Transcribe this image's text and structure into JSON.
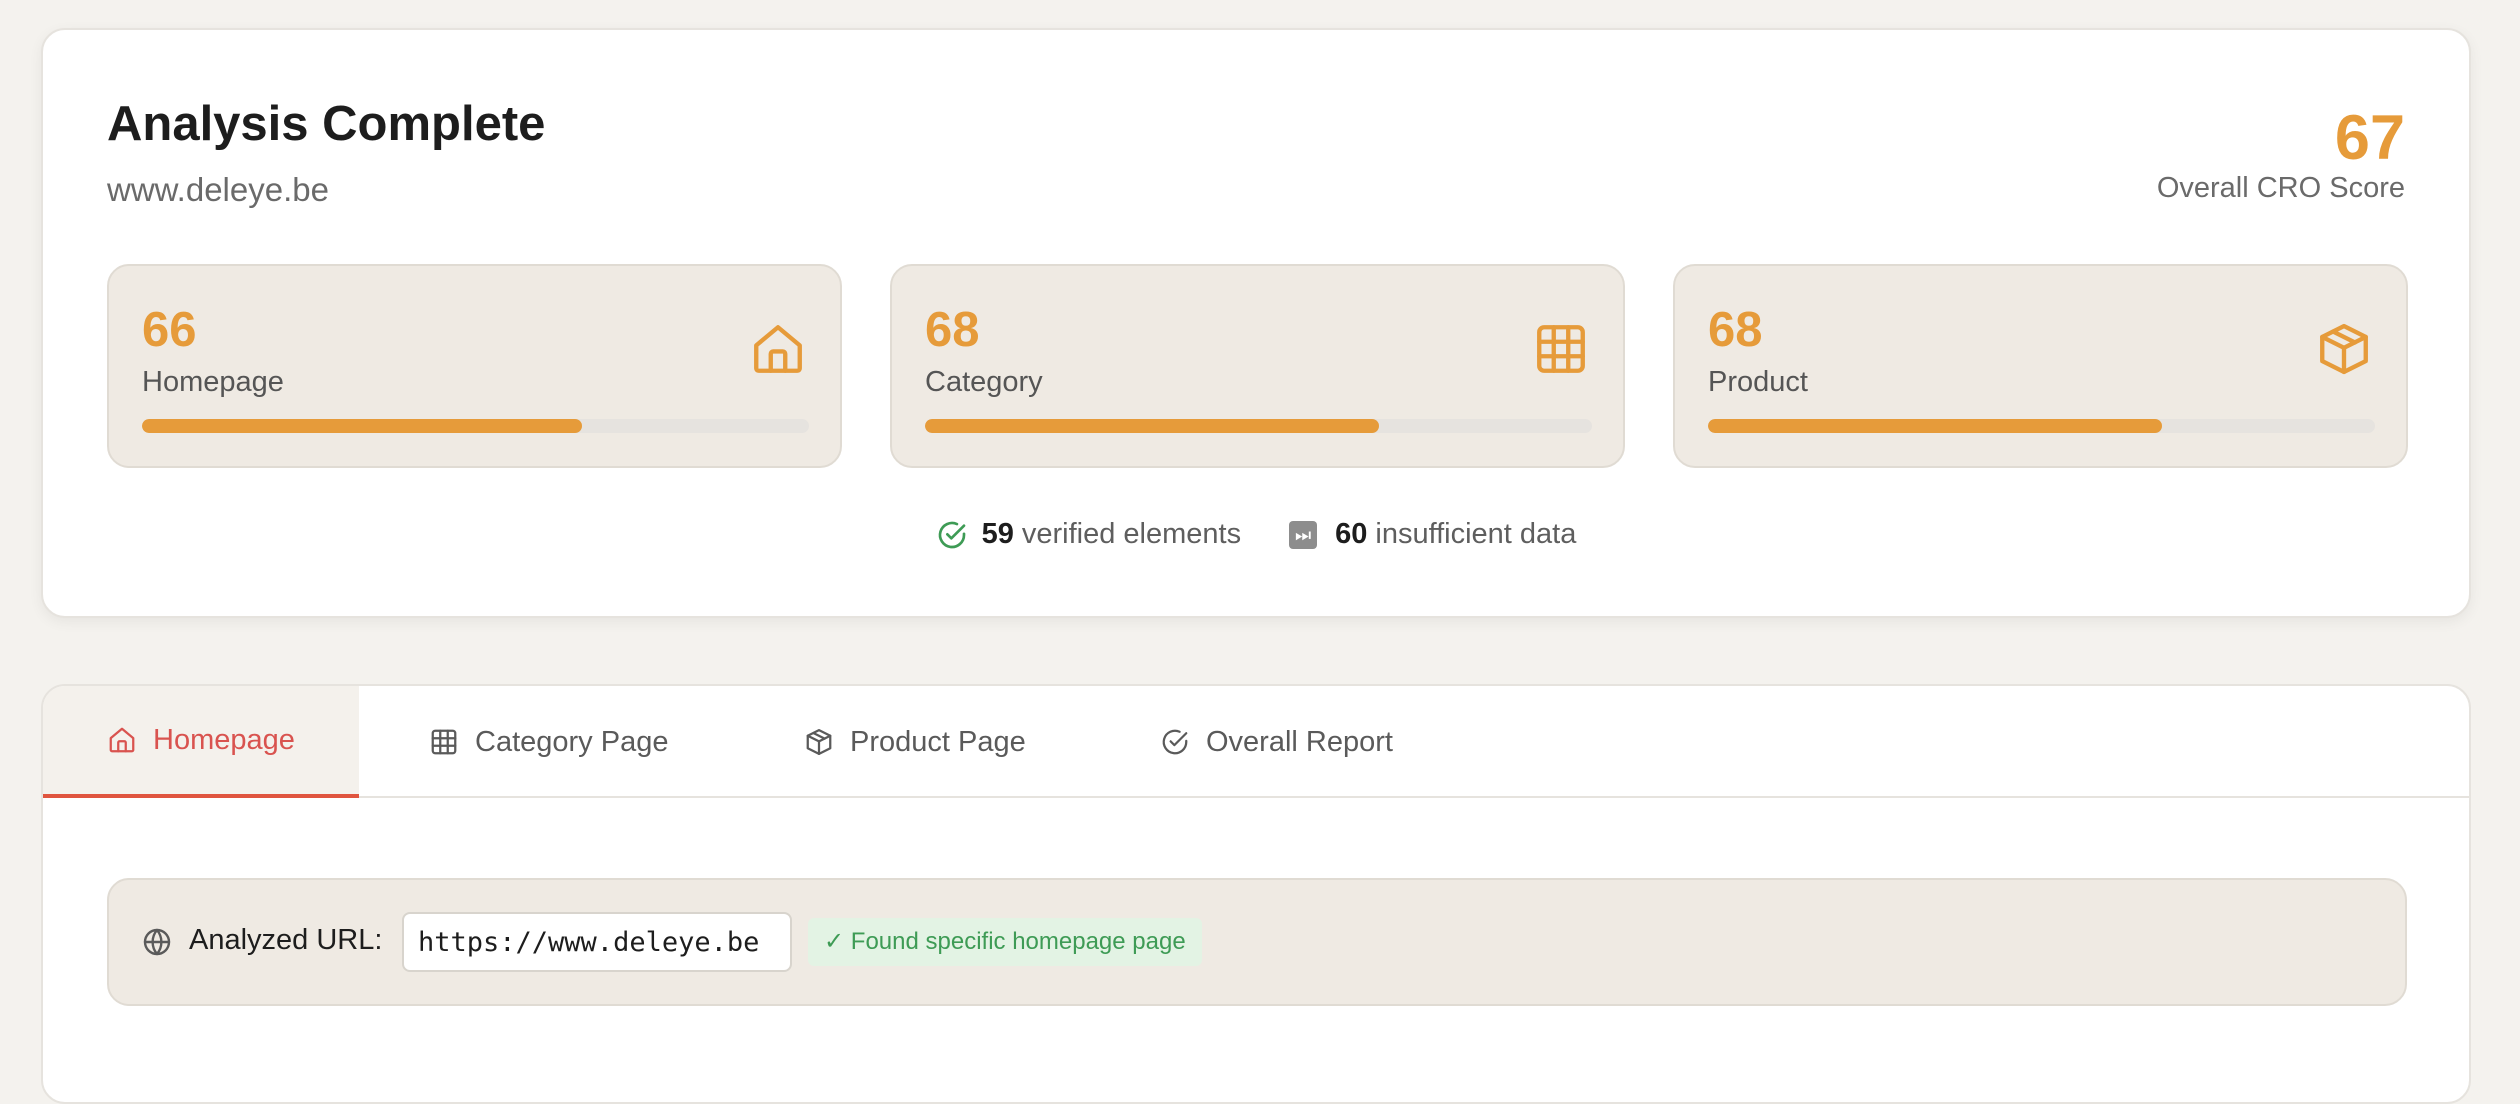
{
  "summary": {
    "title": "Analysis Complete",
    "domain": "www.deleye.be",
    "overall_score": "67",
    "overall_label": "Overall CRO Score",
    "tiles": [
      {
        "score": "66",
        "label": "Homepage",
        "progress": 0.66,
        "icon": "home-icon"
      },
      {
        "score": "68",
        "label": "Category",
        "progress": 0.68,
        "icon": "grid-icon"
      },
      {
        "score": "68",
        "label": "Product",
        "progress": 0.68,
        "icon": "box-icon"
      }
    ],
    "stats": {
      "verified_count": "59",
      "verified_label": "verified elements",
      "insufficient_count": "60",
      "insufficient_label": "insufficient data",
      "insufficient_icon_glyph": "⏭"
    }
  },
  "tabs": [
    {
      "label": "Homepage",
      "icon": "home-icon",
      "active": true
    },
    {
      "label": "Category Page",
      "icon": "grid-icon",
      "active": false
    },
    {
      "label": "Product Page",
      "icon": "box-icon",
      "active": false
    },
    {
      "label": "Overall Report",
      "icon": "check-circle-icon",
      "active": false
    }
  ],
  "analyzed": {
    "label": "Analyzed URL:",
    "url": "https://www.deleye.be",
    "badge": "✓ Found specific homepage page"
  },
  "colors": {
    "accent": "#e69b3a",
    "active_tab": "#d9534f",
    "success": "#3e9b55",
    "tile_bg": "#efeae3"
  }
}
